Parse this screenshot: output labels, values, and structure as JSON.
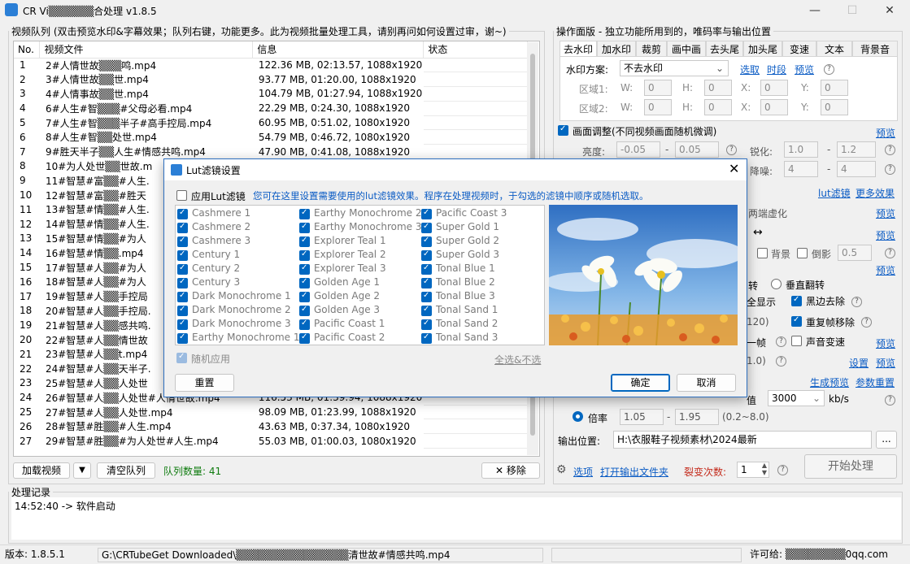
{
  "window": {
    "title": "CR Vi▒▒▒▒▒▒合处理 v1.8.5"
  },
  "queue": {
    "legend": "视频队列 (双击预览水印&字幕效果；队列右键，功能更多。此为视频批量处理工具，请别再问如何设置过审，谢~)",
    "columns": [
      "No.",
      "视频文件",
      "信息",
      "状态"
    ],
    "rows": [
      [
        "1",
        "2#人情世故▒▒▒鸣.mp4",
        "122.36 MB, 02:13.57, 1088x1920"
      ],
      [
        "2",
        "3#人情世故▒▒世.mp4",
        "93.77 MB, 01:20.00, 1088x1920"
      ],
      [
        "3",
        "4#人情事故▒▒世.mp4",
        "104.79 MB, 01:27.94, 1088x1920"
      ],
      [
        "4",
        "6#人生#智▒▒▒#父母必看.mp4",
        "22.29 MB, 0:24.30, 1088x1920"
      ],
      [
        "5",
        "7#人生#智▒▒▒半子#高手控局.mp4",
        "60.95 MB, 0:51.02, 1080x1920"
      ],
      [
        "6",
        "8#人生#智▒▒处世.mp4",
        "54.79 MB, 0:46.72, 1080x1920"
      ],
      [
        "7",
        "9#胜天半子▒▒人生#情感共鸣.mp4",
        "47.90 MB, 0:41.08, 1088x1920"
      ],
      [
        "8",
        "10#为人处世▒▒世故.m",
        ""
      ],
      [
        "9",
        "11#智慧#富▒▒#人生.",
        ""
      ],
      [
        "10",
        "12#智慧#富▒▒#胜天",
        ""
      ],
      [
        "11",
        "13#智慧#情▒▒#人生.",
        ""
      ],
      [
        "12",
        "14#智慧#情▒▒#人生.",
        ""
      ],
      [
        "13",
        "15#智慧#情▒▒#为人",
        ""
      ],
      [
        "14",
        "16#智慧#情▒▒.mp4",
        ""
      ],
      [
        "15",
        "17#智慧#人▒▒#为人",
        ""
      ],
      [
        "16",
        "18#智慧#人▒▒#为人",
        ""
      ],
      [
        "17",
        "19#智慧#人▒▒手控局",
        ""
      ],
      [
        "18",
        "20#智慧#人▒▒手控局.",
        ""
      ],
      [
        "19",
        "21#智慧#人▒▒感共鸣.",
        ""
      ],
      [
        "20",
        "22#智慧#人▒▒情世故",
        ""
      ],
      [
        "21",
        "23#智慧#人▒▒t.mp4",
        ""
      ],
      [
        "22",
        "24#智慧#人▒▒天半子.",
        ""
      ],
      [
        "23",
        "25#智慧#人▒▒人处世",
        ""
      ],
      [
        "24",
        "26#智慧#人▒▒人处世#人情世故.mp4",
        "116.53 MB, 01:39.94, 1088x1920"
      ],
      [
        "25",
        "27#智慧#人▒▒人处世.mp4",
        "98.09 MB, 01:23.99, 1088x1920"
      ],
      [
        "26",
        "28#智慧#胜▒▒#人生.mp4",
        "43.63 MB, 0:37.34, 1080x1920"
      ],
      [
        "27",
        "29#智慧#胜▒▒#为人处世#人生.mp4",
        "55.03 MB, 01:00.03, 1080x1920"
      ]
    ],
    "load_button": "加载视频",
    "clear_button": "清空队列",
    "count_label": "队列数量: 41",
    "remove_button": "移除"
  },
  "ops": {
    "legend": "操作面版 - 独立功能所用到的，唯码率与输出位置",
    "tabs": [
      "去水印",
      "加水印",
      "裁剪",
      "画中画",
      "去头尾",
      "加头尾",
      "变速",
      "文本",
      "背景音"
    ],
    "watermark_label": "水印方案:",
    "watermark_value": "不去水印",
    "select_link": "选取",
    "timeline_link": "时段",
    "preview_link": "预览",
    "region1": "区域1:",
    "region2": "区域2:",
    "w": "W:",
    "h": "H:",
    "x": "X:",
    "y": "Y:",
    "zero": "0",
    "adjust_label": "画面调整(不同视频画面随机微调)",
    "adjust_preview": "预览",
    "brightness": "亮度:",
    "b_min": "-0.05",
    "b_max": "0.05",
    "sharpen": "锐化:",
    "s_min": "1.0",
    "s_max": "1.2",
    "denoise": "降噪:",
    "d_min": "4",
    "d_max": "4",
    "lut_link": "lut滤镜",
    "more_link": "更多效果",
    "blur_label": "两端虚化",
    "preview2": "预览",
    "arrow": "↔",
    "bg_label": "背景",
    "shadow_label": "倒影",
    "shadow_val": "0.5",
    "preview3": "预览",
    "rotate_text": "转",
    "vflip": "垂直翻转",
    "fullshow": "全显示",
    "blackedge": "黑边去除",
    "val120": "120)",
    "dupframe": "重复帧移除",
    "frame": "一帧",
    "audio_speed": "声音变速",
    "preview4": "预览",
    "val10": "1.0)",
    "setting_link": "设置",
    "preview5": "预览",
    "gen_preview": "生成预览",
    "reset_params": "参数重置",
    "bitrate_label": "值",
    "bitrate_value": "3000",
    "bitrate_unit": "kb/s",
    "ratio_label": "倍率",
    "r_min": "1.05",
    "r_max": "1.95",
    "r_range": "(0.2~8.0)",
    "output_label": "输出位置:",
    "output_path": "H:\\衣服鞋子视频素材\\2024最新",
    "browse": "...",
    "options_link": "选项",
    "open_output": "打开输出文件夹",
    "split_label": "裂变次数:",
    "split_value": "1",
    "start_button": "开始处理"
  },
  "log": {
    "legend": "处理记录",
    "entry": "14:52:40 -> 软件启动"
  },
  "statusbar": {
    "version": "版本: 1.8.5.1",
    "path": "G:\\CRTubeGet Downloaded\\▒▒▒▒▒▒▒▒▒▒▒▒▒▒▒清世故#情感共鸣.mp4",
    "license": "许可给: ▒▒▒▒▒▒▒▒0qq.com"
  },
  "dialog": {
    "title": "Lut滤镜设置",
    "apply_label": "应用Lut滤镜",
    "hint": "您可在这里设置需要使用的lut滤镜效果。程序在处理视频时，于勾选的滤镜中顺序或随机选取。",
    "col1": [
      "Cashmere 1",
      "Cashmere 2",
      "Cashmere 3",
      "Century 1",
      "Century 2",
      "Century 3",
      "Dark Monochrome 1",
      "Dark Monochrome 2",
      "Dark Monochrome 3",
      "Earthy Monochrome 1"
    ],
    "col2": [
      "Earthy Monochrome 2",
      "Earthy Monochrome 3",
      "Explorer Teal 1",
      "Explorer Teal 2",
      "Explorer Teal 3",
      "Golden Age 1",
      "Golden Age 2",
      "Golden Age 3",
      "Pacific Coast 1",
      "Pacific Coast 2"
    ],
    "col3": [
      "Pacific Coast 3",
      "Super Gold 1",
      "Super Gold 2",
      "Super Gold 3",
      "Tonal Blue 1",
      "Tonal Blue 2",
      "Tonal Blue 3",
      "Tonal Sand 1",
      "Tonal Sand 2",
      "Tonal Sand 3"
    ],
    "random_label": "随机应用",
    "select_all": "全选&不选",
    "reset_button": "重置",
    "ok_button": "确定",
    "cancel_button": "取消"
  },
  "colors": {
    "accent": "#0067c0",
    "link": "#0a5bc4",
    "green": "#107c10",
    "red": "#c42b1c"
  }
}
